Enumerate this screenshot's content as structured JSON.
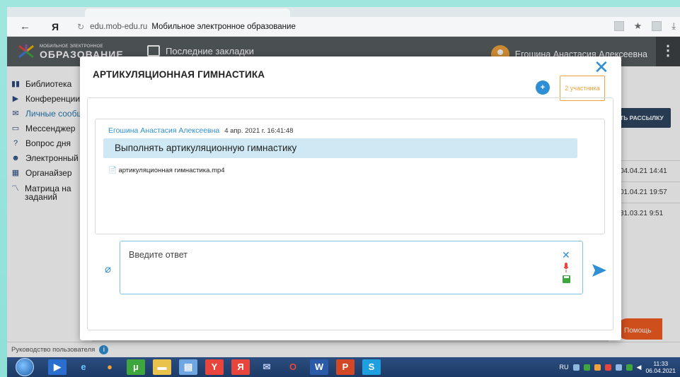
{
  "browser": {
    "ya_label": "Я",
    "url": "edu.mob-edu.ru",
    "page_title": "Мобильное электронное образование"
  },
  "header": {
    "logo_small": "МОБИЛЬНОЕ ЭЛЕКТРОННОЕ",
    "logo_big": "ОБРАЗОВАНИЕ",
    "bookmarks_label": "Последние закладки",
    "user_name": "Егошина Анастасия Алексеевна"
  },
  "sidebar": {
    "items": [
      {
        "label": "Библиотека",
        "icon": "book-icon"
      },
      {
        "label": "Конференции",
        "icon": "video-icon"
      },
      {
        "label": "Личные сообщения",
        "icon": "mail-icon"
      },
      {
        "label": "Мессенджер",
        "icon": "chat-icon"
      },
      {
        "label": "Вопрос дня",
        "icon": "question-icon"
      },
      {
        "label": "Электронный",
        "icon": "person-icon"
      },
      {
        "label": "Органайзер",
        "icon": "calendar-icon"
      },
      {
        "label": "Матрица на заданий",
        "icon": "chart-line-icon"
      }
    ]
  },
  "right_panel": {
    "button_label": "ТЬ РАССЫЛКУ",
    "dates": [
      "04.04.21 14:41",
      "01.04.21 19:57",
      "31.03.21 9:51"
    ],
    "help_label": "Помощь"
  },
  "footer": {
    "guide_label": "Руководство пользователя"
  },
  "modal": {
    "title": "АРТИКУЛЯЦИОННАЯ ГИМНАСТИКА",
    "participants_label": "2 участника",
    "message": {
      "author": "Егошина Анастасия Алексеевна",
      "date": "4 апр. 2021 г. 16:41:48",
      "text": "Выполнять артикуляционную гимнастику",
      "attachment": "артикуляционная гимнастика.mp4"
    },
    "reply_placeholder": "Введите ответ"
  },
  "taskbar": {
    "lang": "RU",
    "time": "11:33",
    "date": "06.04.2021"
  },
  "colors": {
    "accent": "#2f8fd4",
    "orange": "#f0a23d",
    "header_bg": "#585d61",
    "bubble_bg": "#cfe9f4",
    "help_bg": "#f25c22"
  }
}
